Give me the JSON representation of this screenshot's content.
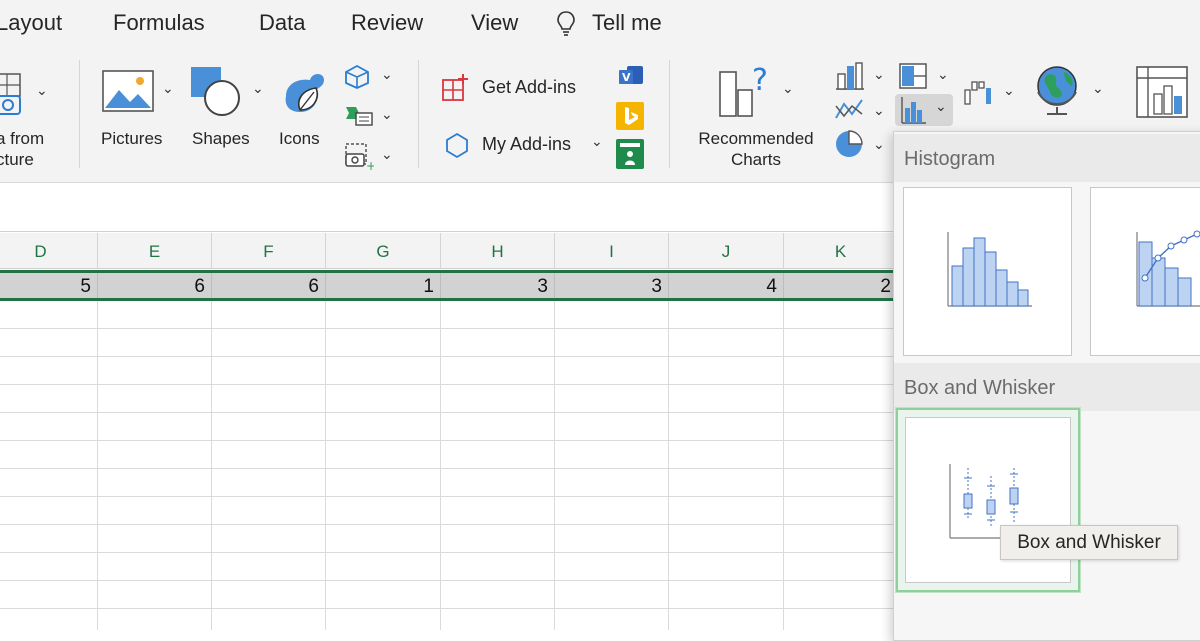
{
  "tabs": [
    "Layout",
    "Formulas",
    "Data",
    "Review",
    "View",
    "Tell me"
  ],
  "ribbon": {
    "from_picture_line1": "a from",
    "from_picture_line2": "cture",
    "pictures": "Pictures",
    "shapes": "Shapes",
    "icons": "Icons",
    "get_addins": "Get Add-ins",
    "my_addins": "My Add-ins",
    "recommended_line1": "Recommended",
    "recommended_line2": "Charts"
  },
  "columns": [
    "D",
    "E",
    "F",
    "G",
    "H",
    "I",
    "J",
    "K"
  ],
  "row_values": [
    "5",
    "6",
    "6",
    "1",
    "3",
    "3",
    "4",
    "2"
  ],
  "dropdown": {
    "histogram_header": "Histogram",
    "box_whisker_header": "Box and Whisker",
    "tooltip": "Box and Whisker"
  },
  "colors": {
    "accent_green": "#217346",
    "chart_blue": "#4472c4",
    "selection_green": "#8fcf9c"
  },
  "icons": [
    "picture-from-file-icon",
    "pictures-icon",
    "shapes-icon",
    "icons-icon",
    "3d-models-icon",
    "smartart-icon",
    "screenshot-icon",
    "get-addins-icon",
    "my-addins-icon",
    "visio-icon",
    "bing-maps-icon",
    "people-graph-icon",
    "recommended-charts-icon",
    "column-chart-icon",
    "line-chart-icon",
    "pie-chart-icon",
    "hierarchy-chart-icon",
    "statistic-chart-icon",
    "waterfall-chart-icon",
    "maps-icon",
    "pivot-chart-icon",
    "lightbulb-icon"
  ]
}
